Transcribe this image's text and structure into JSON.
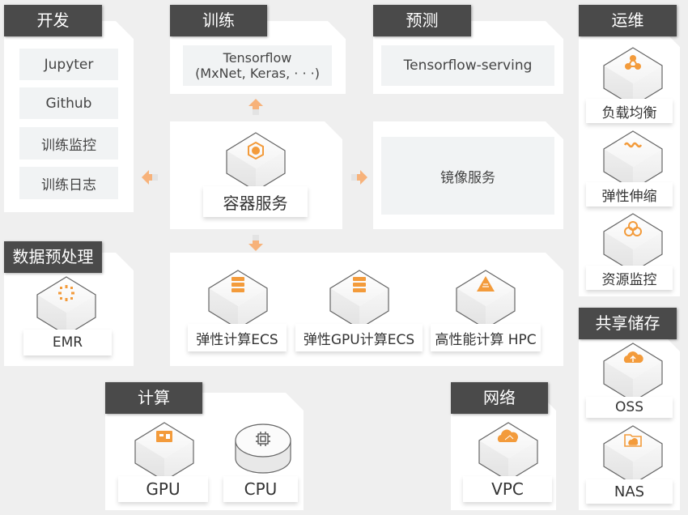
{
  "colors": {
    "accent": "#f39b3b",
    "tag_bg": "#4a4a4a",
    "page_bg": "#efefef",
    "item_bg": "#f1f3f4"
  },
  "dev": {
    "title": "开发",
    "items": [
      "Jupyter",
      "Github",
      "训练监控",
      "训练日志"
    ]
  },
  "train": {
    "title": "训练",
    "line1": "Tensorflow",
    "line2": "(MxNet, Keras, · · ·)"
  },
  "predict": {
    "title": "预测",
    "item": "Tensorflow-serving"
  },
  "container": {
    "label": "容器服务",
    "icon": "container-icon"
  },
  "image_service": {
    "label": "镜像服务"
  },
  "ops": {
    "title": "运维",
    "items": [
      {
        "label": "负载均衡",
        "icon": "load-balance-icon"
      },
      {
        "label": "弹性伸缩",
        "icon": "auto-scaling-icon"
      },
      {
        "label": "资源监控",
        "icon": "resource-monitor-icon"
      }
    ]
  },
  "preprocess": {
    "title": "数据预处理",
    "items": [
      {
        "label": "EMR",
        "icon": "emr-icon"
      }
    ]
  },
  "compute_services": {
    "items": [
      {
        "label": "弹性计算ECS",
        "icon": "server-icon"
      },
      {
        "label": "弹性GPU计算ECS",
        "icon": "server-icon"
      },
      {
        "label": "高性能计算 HPC",
        "icon": "hpc-icon"
      }
    ]
  },
  "compute": {
    "title": "计算",
    "items": [
      {
        "label": "GPU",
        "icon": "gpu-icon"
      },
      {
        "label": "CPU",
        "icon": "cpu-chip-icon"
      }
    ]
  },
  "network": {
    "title": "网络",
    "items": [
      {
        "label": "VPC",
        "icon": "vpc-cloud-icon"
      }
    ]
  },
  "storage": {
    "title": "共享储存",
    "items": [
      {
        "label": "OSS",
        "icon": "oss-upload-icon"
      },
      {
        "label": "NAS",
        "icon": "nas-folder-icon"
      }
    ]
  }
}
